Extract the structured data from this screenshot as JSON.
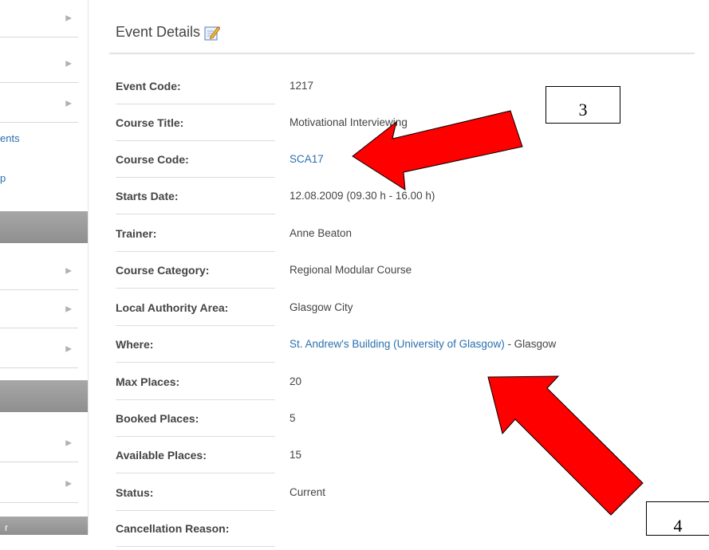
{
  "sidebar": {
    "link_1": "ents",
    "link_2": "p",
    "bottom_bar_text": "r"
  },
  "main": {
    "title": "Event Details"
  },
  "details": [
    {
      "label": "Event Code:",
      "value": "1217"
    },
    {
      "label": "Course Title:",
      "value": "Motivational Interviewing"
    },
    {
      "label": "Course Code:",
      "value": "SCA17"
    },
    {
      "label": "Starts Date:",
      "value": "12.08.2009 (09.30 h - 16.00 h)"
    },
    {
      "label": "Trainer:",
      "value": "Anne Beaton"
    },
    {
      "label": "Course Category:",
      "value": "Regional Modular Course"
    },
    {
      "label": "Local Authority Area:",
      "value": "Glasgow City"
    },
    {
      "label": "Where:",
      "value": "St. Andrew's Building (University of Glasgow)",
      "suffix": " - Glasgow"
    },
    {
      "label": "Max Places:",
      "value": "20"
    },
    {
      "label": "Booked Places:",
      "value": "5"
    },
    {
      "label": "Available Places:",
      "value": "15"
    },
    {
      "label": "Status:",
      "value": "Current"
    },
    {
      "label": "Cancellation Reason:",
      "value": ""
    }
  ],
  "annotations": {
    "box_3": "3",
    "box_4": "4"
  },
  "colors": {
    "link": "#2a6fb0",
    "arrow": "#ff0000",
    "sidebar_bar": "#9a9a9a"
  }
}
